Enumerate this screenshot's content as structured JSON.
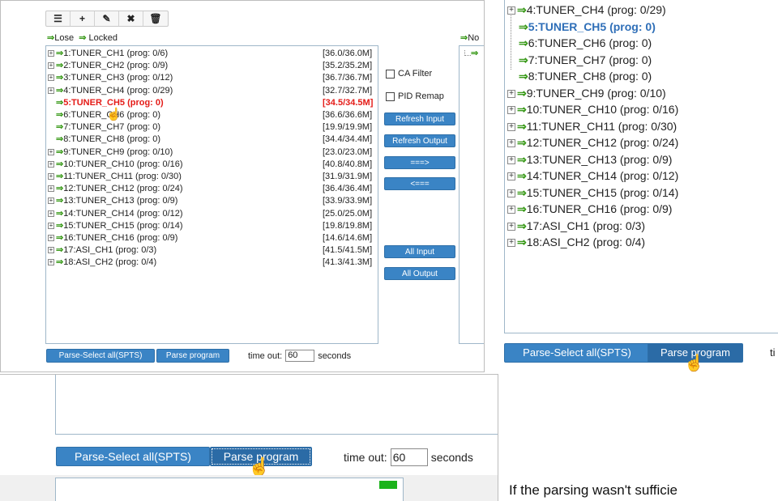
{
  "toolbar": {
    "items": [
      {
        "icon": "list-icon",
        "glyph": "☰"
      },
      {
        "icon": "add-icon",
        "glyph": "+"
      },
      {
        "icon": "edit-icon",
        "glyph": "✎"
      },
      {
        "icon": "delete-x-icon",
        "glyph": "✖"
      },
      {
        "icon": "trash-icon",
        "glyph": "🗑"
      }
    ]
  },
  "input_header": {
    "lose": "Lose",
    "locked": "Locked"
  },
  "output_header": {
    "label": "No"
  },
  "channels": [
    {
      "name": "1:TUNER_CH1 (prog: 0/6)",
      "bw": "[36.0/36.0M]",
      "expand": true
    },
    {
      "name": "2:TUNER_CH2 (prog: 0/9)",
      "bw": "[35.2/35.2M]",
      "expand": true
    },
    {
      "name": "3:TUNER_CH3 (prog: 0/12)",
      "bw": "[36.7/36.7M]",
      "expand": true
    },
    {
      "name": "4:TUNER_CH4 (prog: 0/29)",
      "bw": "[32.7/32.7M]",
      "expand": true
    },
    {
      "name": "5:TUNER_CH5 (prog: 0)",
      "bw": "[34.5/34.5M]",
      "expand": false,
      "selected": true
    },
    {
      "name": "6:TUNER_CH6 (prog: 0)",
      "bw": "[36.6/36.6M]",
      "expand": false
    },
    {
      "name": "7:TUNER_CH7 (prog: 0)",
      "bw": "[19.9/19.9M]",
      "expand": false
    },
    {
      "name": "8:TUNER_CH8 (prog: 0)",
      "bw": "[34.4/34.4M]",
      "expand": false
    },
    {
      "name": "9:TUNER_CH9 (prog: 0/10)",
      "bw": "[23.0/23.0M]",
      "expand": true
    },
    {
      "name": "10:TUNER_CH10 (prog: 0/16)",
      "bw": "[40.8/40.8M]",
      "expand": true
    },
    {
      "name": "11:TUNER_CH11 (prog: 0/30)",
      "bw": "[31.9/31.9M]",
      "expand": true
    },
    {
      "name": "12:TUNER_CH12 (prog: 0/24)",
      "bw": "[36.4/36.4M]",
      "expand": true
    },
    {
      "name": "13:TUNER_CH13 (prog: 0/9)",
      "bw": "[33.9/33.9M]",
      "expand": true
    },
    {
      "name": "14:TUNER_CH14 (prog: 0/12)",
      "bw": "[25.0/25.0M]",
      "expand": true
    },
    {
      "name": "15:TUNER_CH15 (prog: 0/14)",
      "bw": "[19.8/19.8M]",
      "expand": true
    },
    {
      "name": "16:TUNER_CH16 (prog: 0/9)",
      "bw": "[14.6/14.6M]",
      "expand": true
    },
    {
      "name": "17:ASI_CH1 (prog: 0/3)",
      "bw": "[41.5/41.5M]",
      "expand": true
    },
    {
      "name": "18:ASI_CH2 (prog: 0/4)",
      "bw": "[41.3/41.3M]",
      "expand": true
    }
  ],
  "options": {
    "ca_filter": "CA Filter",
    "pid_remap": "PID Remap"
  },
  "buttons": {
    "refresh_input": "Refresh Input",
    "refresh_output": "Refresh Output",
    "move_right": "===>",
    "move_left": "<===",
    "all_input": "All Input",
    "all_output": "All Output"
  },
  "footer": {
    "parse_select_all": "Parse-Select all(SPTS)",
    "parse_program": "Parse program",
    "timeout_label": "time out:",
    "timeout_value": "60",
    "seconds": "seconds",
    "truncated_timeout": "ti"
  },
  "caption": "If the parsing wasn't sufficie",
  "colors": {
    "selected": "#e41b17",
    "selected_zoom": "#2f6fb8",
    "button": "#3a84c5",
    "arrow": "#3a9a1a"
  }
}
